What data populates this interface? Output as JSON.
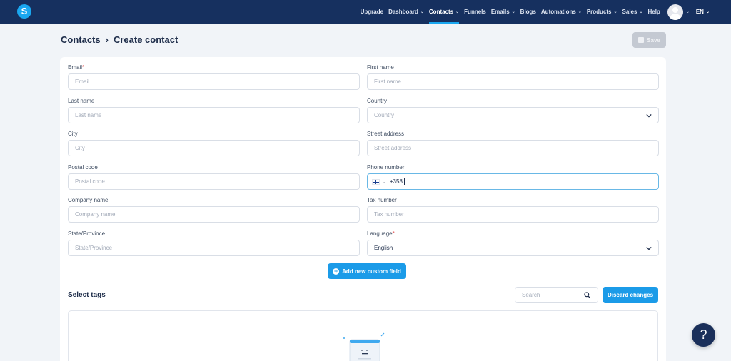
{
  "nav": {
    "logo": "S",
    "items": [
      {
        "label": "Upgrade",
        "dropdown": false,
        "active": false
      },
      {
        "label": "Dashboard",
        "dropdown": true,
        "active": false
      },
      {
        "label": "Contacts",
        "dropdown": true,
        "active": true
      },
      {
        "label": "Funnels",
        "dropdown": false,
        "active": false
      },
      {
        "label": "Emails",
        "dropdown": true,
        "active": false
      },
      {
        "label": "Blogs",
        "dropdown": false,
        "active": false
      },
      {
        "label": "Automations",
        "dropdown": true,
        "active": false
      },
      {
        "label": "Products",
        "dropdown": true,
        "active": false
      },
      {
        "label": "Sales",
        "dropdown": true,
        "active": false
      },
      {
        "label": "Help",
        "dropdown": false,
        "active": false
      }
    ],
    "language": "EN"
  },
  "breadcrumb": {
    "parent": "Contacts",
    "current": "Create contact"
  },
  "save_label": "Save",
  "form": {
    "email": {
      "label": "Email",
      "required": "*",
      "placeholder": "Email"
    },
    "first_name": {
      "label": "First name",
      "placeholder": "First name"
    },
    "last_name": {
      "label": "Last name",
      "placeholder": "Last name"
    },
    "country": {
      "label": "Country",
      "placeholder": "Country"
    },
    "city": {
      "label": "City",
      "placeholder": "City"
    },
    "street_address": {
      "label": "Street address",
      "placeholder": "Street address"
    },
    "postal_code": {
      "label": "Postal code",
      "placeholder": "Postal code"
    },
    "phone": {
      "label": "Phone number",
      "value": "+358",
      "country_flag": "finland-flag-icon"
    },
    "company_name": {
      "label": "Company name",
      "placeholder": "Company name"
    },
    "tax_number": {
      "label": "Tax number",
      "placeholder": "Tax number"
    },
    "state": {
      "label": "State/Province",
      "placeholder": "State/Province"
    },
    "language": {
      "label": "Language",
      "required": "*",
      "value": "English"
    }
  },
  "add_custom_field_label": "Add new custom field",
  "tags": {
    "title": "Select tags",
    "search_placeholder": "Search",
    "discard_label": "Discard changes"
  },
  "help_label": "?",
  "colors": {
    "nav_bg": "#16305f",
    "accent": "#1b9be8",
    "page_bg": "#f1f4f8",
    "disabled": "#c4c9d2"
  }
}
